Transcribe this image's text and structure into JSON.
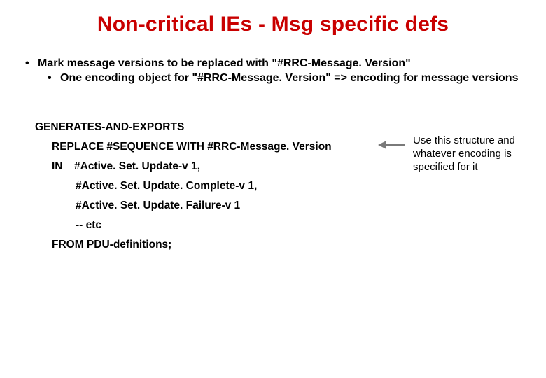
{
  "title": "Non-critical IEs - Msg specific defs",
  "bullet1": "Mark message versions to be replaced with \"#RRC-Message. Version\"",
  "bullet2": "One encoding object for \"#RRC-Message. Version\" => encoding for message versions",
  "code": {
    "l1": "GENERATES-AND-EXPORTS",
    "l2": "REPLACE #SEQUENCE WITH #RRC-Message. Version",
    "in": "IN",
    "l3": "#Active. Set. Update-v 1,",
    "l4": "#Active. Set. Update. Complete-v 1,",
    "l5": "#Active. Set. Update. Failure-v 1",
    "l6": "-- etc",
    "l7": "FROM PDU-definitions;"
  },
  "annotation": "Use this structure and whatever encoding is specified for it"
}
